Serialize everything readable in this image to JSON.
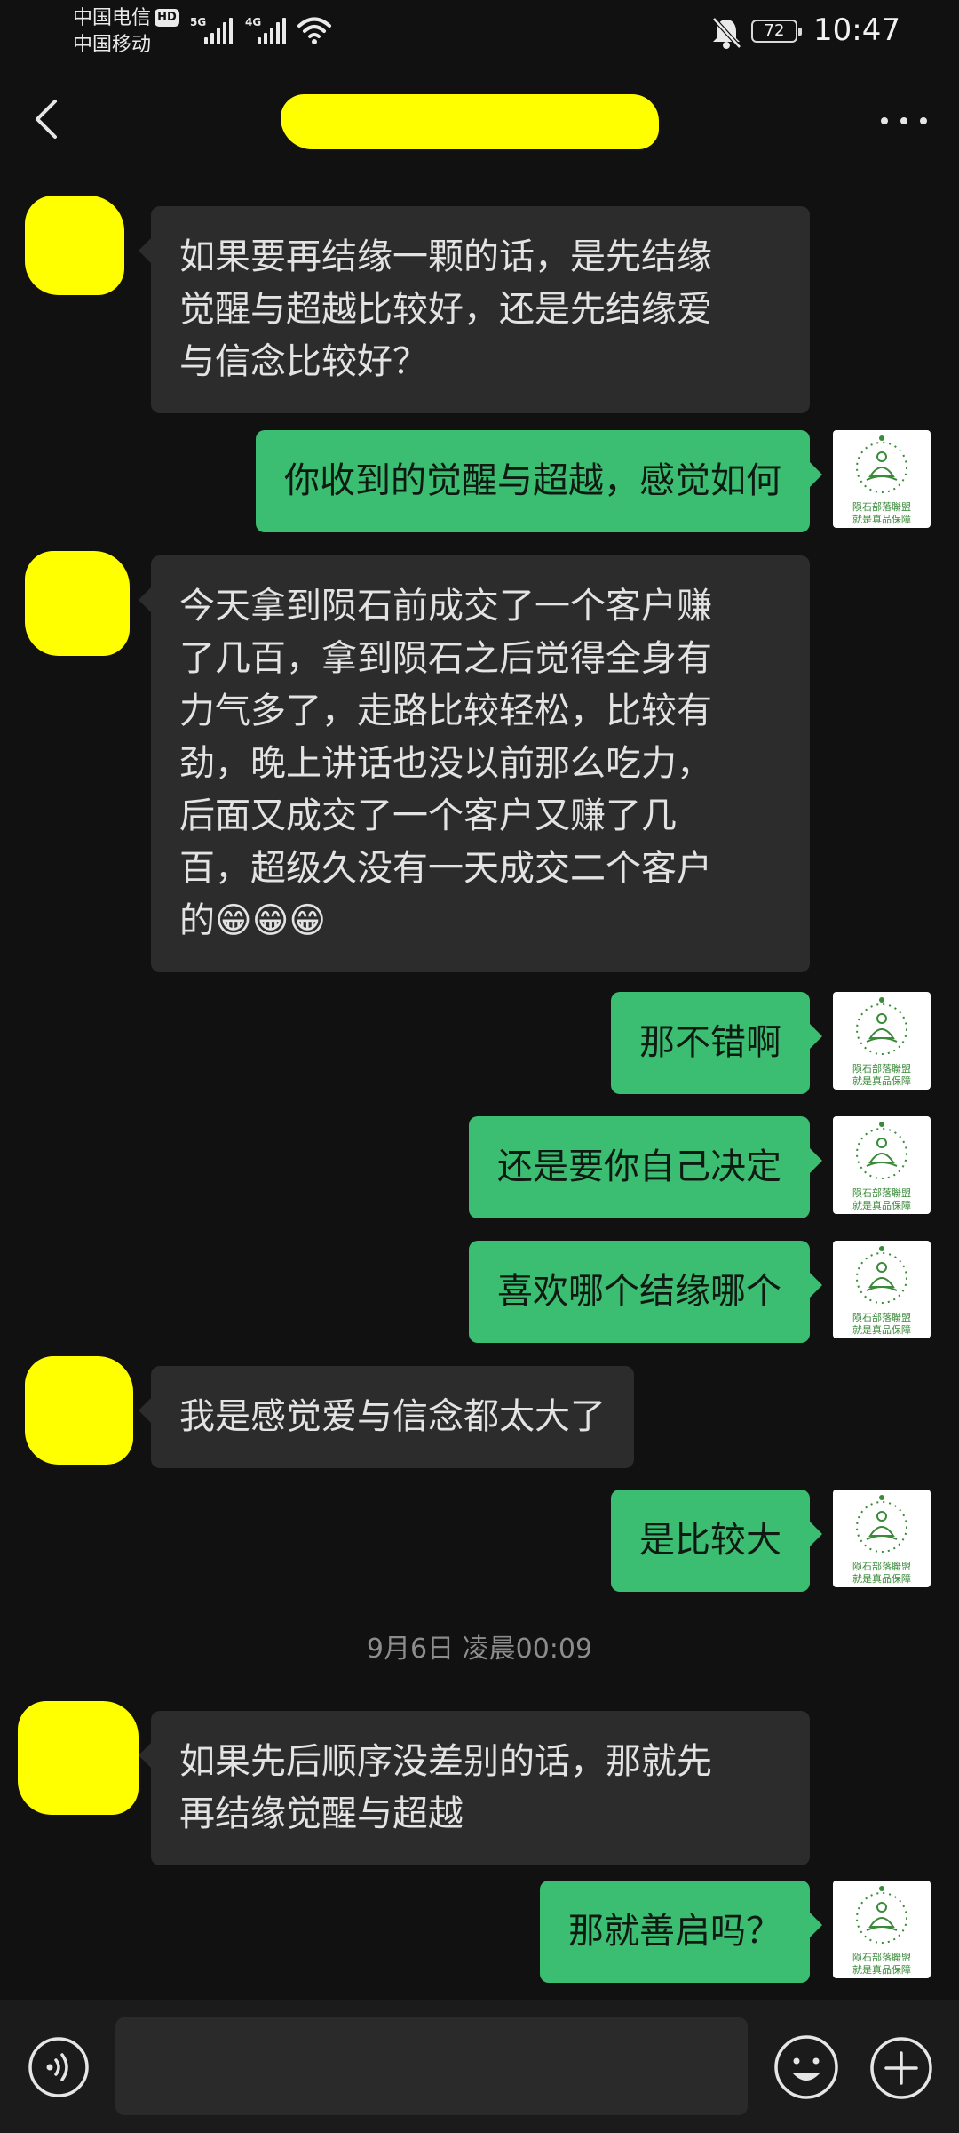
{
  "status_bar": {
    "carrier_1": "中国电信",
    "carrier_2": "中国移动",
    "hd_badge": "HD",
    "net_1": "5G",
    "net_2": "4G",
    "battery": "72",
    "time": "10:47",
    "icons": [
      "signal-icon",
      "wifi-icon",
      "bell-muted-icon",
      "battery-icon"
    ]
  },
  "title_bar": {
    "back_icon": "chevron-left-icon",
    "more_icon": "more-dots-icon"
  },
  "messages": [
    {
      "side": "in",
      "text": "如果要再结缘一颗的话，是先结缘\n觉醒与超越比较好，还是先结缘爱\n与信念比较好？"
    },
    {
      "side": "out",
      "text": "你收到的觉醒与超越，感觉如何"
    },
    {
      "side": "in",
      "text": "今天拿到陨石前成交了一个客户赚\n了几百，拿到陨石之后觉得全身有\n力气多了，走路比较轻松，比较有\n劲，晚上讲话也没以前那么吃力，\n后面又成交了一个客户又赚了几\n百，超级久没有一天成交二个客户\n的😁😁😁"
    },
    {
      "side": "out",
      "text": "那不错啊"
    },
    {
      "side": "out",
      "text": "还是要你自己决定"
    },
    {
      "side": "out",
      "text": "喜欢哪个结缘哪个"
    },
    {
      "side": "in",
      "text": "我是感觉爱与信念都太大了"
    },
    {
      "side": "out",
      "text": "是比较大"
    },
    {
      "side": "in",
      "text": "如果先后顺序没差别的话，那就先\n再结缘觉醒与超越"
    },
    {
      "side": "out",
      "text": "那就善启吗？"
    }
  ],
  "timestamp": "9月6日 凌晨00:09",
  "self_avatar": {
    "line_1": "陨石部落聯盟",
    "line_2": "就是真品保障",
    "color": "#3a8a3a"
  },
  "input_bar": {
    "value": "",
    "voice_icon": "voice-icon",
    "emoji_icon": "emoji-icon",
    "plus_icon": "plus-icon"
  },
  "colors": {
    "background": "#111111",
    "incoming_bubble": "#2c2c2c",
    "outgoing_bubble": "#3bbd72",
    "redaction": "#ffff00"
  }
}
